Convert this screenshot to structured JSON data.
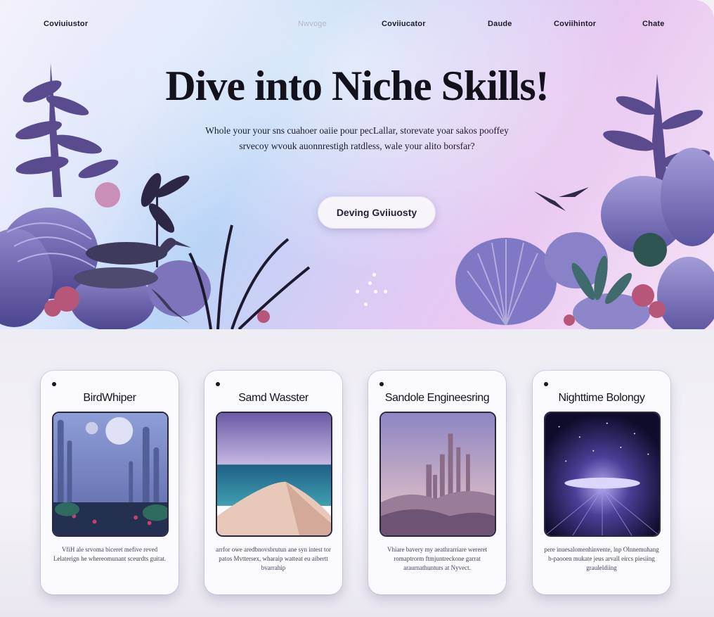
{
  "nav": {
    "items": [
      {
        "label": "Coviuiustor",
        "style": "bold"
      },
      {
        "label": "Nwvoge",
        "style": "faded"
      },
      {
        "label": "Coviiucator",
        "style": "bold"
      },
      {
        "label": "Daude",
        "style": "bold"
      },
      {
        "label": "Coviihintor",
        "style": "bold"
      },
      {
        "label": "Chate",
        "style": "bold"
      }
    ]
  },
  "hero": {
    "headline": "Dive into Niche Skills!",
    "subline_1": "Whole your your sns cuahoer oaiie pour pecLallar, storevate yoar sakos pooffey",
    "subline_2": "srvecoy wvouk auonnrestigh ratdless, wale your alito borsfar?",
    "cta_label": "Deving Gviiuosty",
    "carousel_dot_count": 6
  },
  "cards": [
    {
      "title": "BirdWhiper",
      "image": "misty-forest-moons",
      "desc": "VfiH ale srvoma biceret mefive reved Lelaterign he whereomunant sceurdts guitat."
    },
    {
      "title": "Samd Wasster",
      "image": "sand-dune-ocean",
      "desc": "arrfor owe aredbnovsbrutun ane syn intest tor patos Mvttersex, wharaip watteat eu aibertt bvarrahip"
    },
    {
      "title": "Sandole Engineesring",
      "image": "sand-castle-towers",
      "desc": "Vhiare bavery my aeathrarriare wereret romaptrorm ftmjuntreckone garrat araurnathunturs at Nyvect."
    },
    {
      "title": "Nighttime Bolongy",
      "image": "starry-night-glow",
      "desc": "pere inuesalomenhinvente, lnp Olnnemuhang b-paooen mukate jeus arvall eircs piesiing grauleldiing"
    }
  ],
  "colors": {
    "accent_purple": "#6e5fa8",
    "headline": "#13111c",
    "card_bg": "#fbfaff"
  }
}
